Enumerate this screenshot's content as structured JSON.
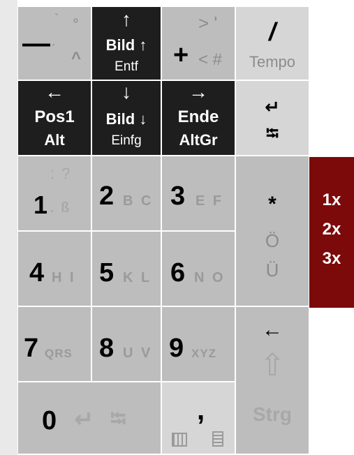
{
  "keys": {
    "dash": {
      "main": "—",
      "top": "`",
      "circ": "°",
      "acute": "´",
      "caret": "^"
    },
    "pgup": {
      "arrow": "↑",
      "label": "Bild",
      "label_arrow": "↑",
      "sub": "Entf"
    },
    "plus": {
      "top": "> '",
      "main": "+",
      "sub": "< #"
    },
    "slash": {
      "main": "/",
      "sub": "Tempo"
    },
    "home": {
      "arrow": "←",
      "label": "Pos1",
      "sub": "Alt"
    },
    "pgdn": {
      "arrow": "↓",
      "label": "Bild",
      "label_arrow": "↓",
      "sub": "Einfg"
    },
    "end": {
      "arrow": "→",
      "label": "Ende",
      "sub": "AltGr"
    },
    "enter_tab": {
      "enter": "↵",
      "tab": "⭾"
    },
    "k1": {
      "main": "1",
      "top": ": ?",
      "sub": ". ß"
    },
    "k2": {
      "main": "2",
      "sub": "B C"
    },
    "k3": {
      "main": "3",
      "sub": "E F"
    },
    "k4": {
      "main": "4",
      "sub": "H I"
    },
    "k5": {
      "main": "5",
      "sub": "K L"
    },
    "k6": {
      "main": "6",
      "sub": "N O"
    },
    "k7": {
      "main": "7",
      "sub": "QRS"
    },
    "k8": {
      "main": "8",
      "sub": "U V"
    },
    "k9": {
      "main": "9",
      "sub": "XYZ"
    },
    "k0": {
      "main": "0",
      "enter": "↵",
      "tab": "⭾"
    },
    "comma": {
      "main": ","
    },
    "star": {
      "main": "*",
      "o": "Ö",
      "u": "Ü"
    },
    "backspace": {
      "arrow": "←",
      "shift": "⇧",
      "ctrl": "Strg"
    }
  },
  "multiplier": {
    "x1": "1x",
    "x2": "2x",
    "x3": "3x"
  }
}
